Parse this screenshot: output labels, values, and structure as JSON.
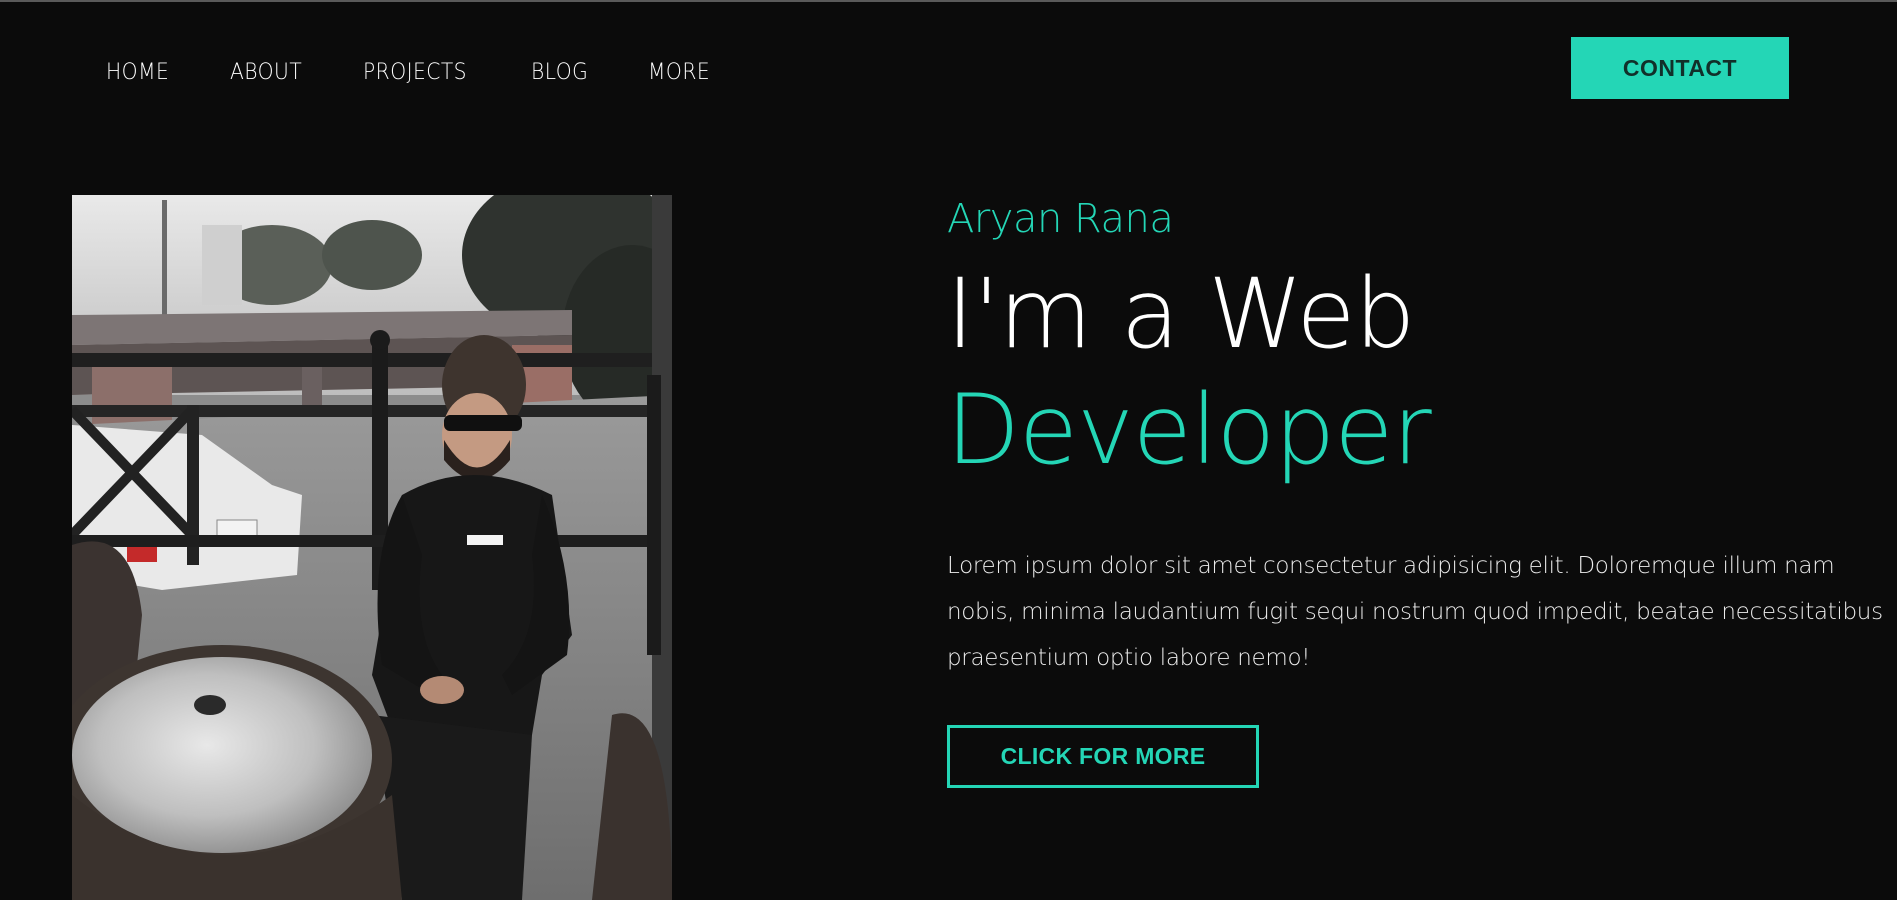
{
  "nav": {
    "items": [
      {
        "label": "HOME"
      },
      {
        "label": "ABOUT"
      },
      {
        "label": "PROJECTS"
      },
      {
        "label": "BLOG"
      },
      {
        "label": "MORE"
      }
    ],
    "contact_label": "CONTACT"
  },
  "hero": {
    "name": "Aryan Rana",
    "line1": "I'm a Web",
    "line2": "Developer",
    "description": "Lorem ipsum dolor sit amet consectetur adipisicing elit. Doloremque illum nam nobis, minima laudantium fugit sequi nostrum quod impedit, beatae necessitatibus praesentium optio labore nemo!",
    "cta_label": "CLICK FOR MORE"
  },
  "colors": {
    "background": "#0b0b0b",
    "accent": "#24d6b6",
    "text": "#ffffff"
  }
}
